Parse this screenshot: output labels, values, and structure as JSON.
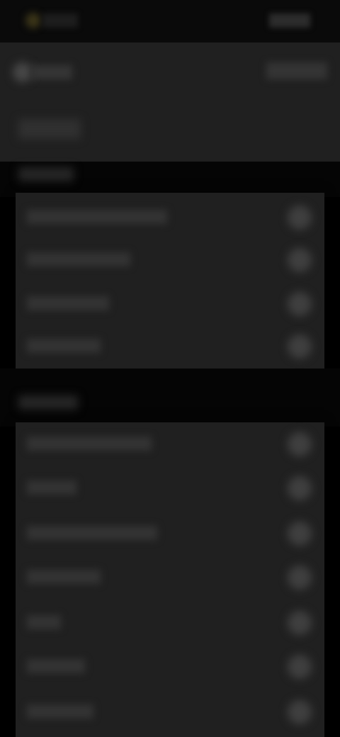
{
  "status_bar": {
    "left_text": "",
    "right_text": ""
  },
  "header": {
    "back_label": "",
    "action_label": "",
    "title": ""
  },
  "sections": [
    {
      "label": "",
      "items": [
        {
          "label": ""
        },
        {
          "label": ""
        },
        {
          "label": ""
        },
        {
          "label": ""
        }
      ]
    },
    {
      "label": "",
      "items": [
        {
          "label": ""
        },
        {
          "label": ""
        },
        {
          "label": ""
        },
        {
          "label": ""
        },
        {
          "label": ""
        },
        {
          "label": ""
        },
        {
          "label": ""
        }
      ]
    }
  ],
  "colors": {
    "background": "#000000",
    "surface": "#202020",
    "accent": "#3a3418"
  },
  "icons": {
    "back": "back-icon",
    "status": "status-dot-icon",
    "toggle": "toggle-icon"
  }
}
